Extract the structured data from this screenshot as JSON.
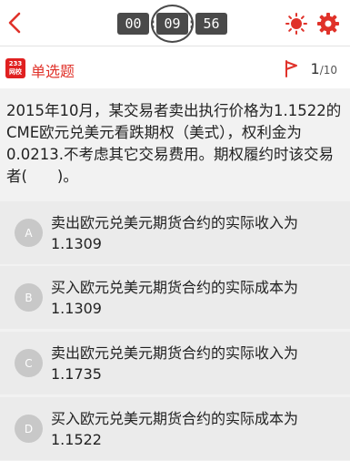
{
  "header": {
    "timer": {
      "hours": "00",
      "minutes": "09",
      "seconds": "56"
    }
  },
  "question_header": {
    "logo_lines": [
      "233",
      "网校"
    ],
    "type_label": "单选题",
    "current": "1",
    "total": "/10"
  },
  "question": {
    "text": "2015年10月，某交易者卖出执行价格为1.1522的CME欧元兑美元看跌期权（美式），权利金为0.0213.不考虑其它交易费用。期权履约时该交易者(　　)。"
  },
  "options": [
    {
      "letter": "A",
      "text": "卖出欧元兑美元期货合约的实际收入为1.1309"
    },
    {
      "letter": "B",
      "text": "买入欧元兑美元期货合约的实际成本为1.1309"
    },
    {
      "letter": "C",
      "text": "卖出欧元兑美元期货合约的实际收入为1.1735"
    },
    {
      "letter": "D",
      "text": "买入欧元兑美元期货合约的实际成本为1.1522"
    }
  ],
  "colors": {
    "accent": "#e0322a",
    "timer_bg": "#4a4a4a",
    "option_bg": "#ebebeb",
    "badge_bg": "#c8c8c8"
  },
  "icons": [
    "back-arrow-icon",
    "brightness-icon",
    "settings-gear-icon",
    "flag-icon"
  ]
}
